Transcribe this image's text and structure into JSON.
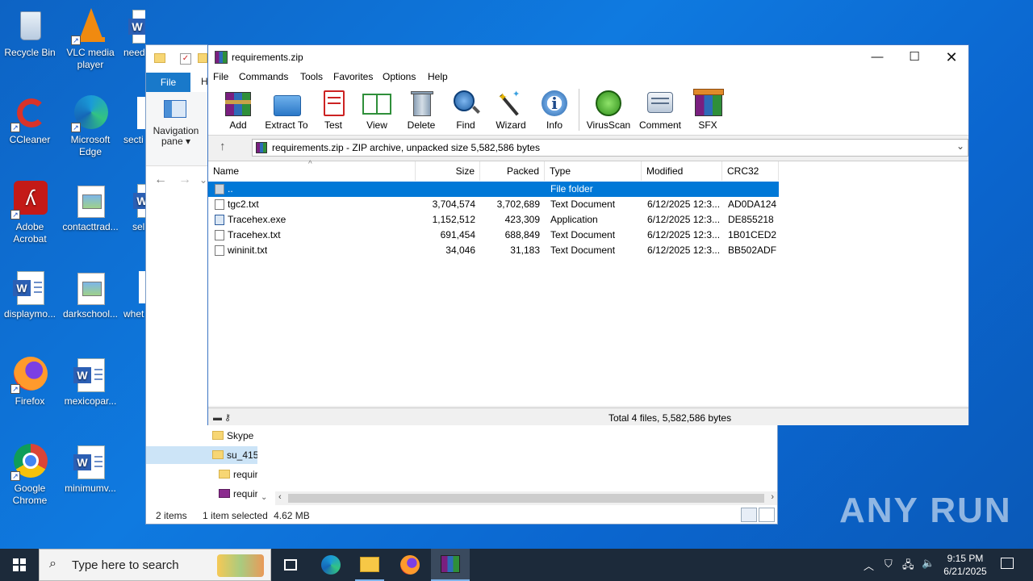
{
  "desktop": {
    "icons": [
      {
        "label": "Recycle Bin"
      },
      {
        "label": "VLC media player"
      },
      {
        "label": "need"
      },
      {
        "label": "CCleaner"
      },
      {
        "label": "Microsoft Edge"
      },
      {
        "label": "secti"
      },
      {
        "label": "Adobe Acrobat"
      },
      {
        "label": "contacttrad..."
      },
      {
        "label": "sel"
      },
      {
        "label": "displaymo..."
      },
      {
        "label": "darkschool..."
      },
      {
        "label": "whet"
      },
      {
        "label": "Firefox"
      },
      {
        "label": "mexicopar..."
      },
      {
        "label": "Google Chrome"
      },
      {
        "label": "minimumv..."
      }
    ]
  },
  "explorer": {
    "file_tab": "File",
    "h_tab": "H",
    "nav_pane": "Navigation pane",
    "nav_pane_arrow": "▾",
    "tree": [
      {
        "label": "Skype"
      },
      {
        "label": "su_415"
      },
      {
        "label": "requir"
      },
      {
        "label": "requir"
      }
    ],
    "status_items": "2 items",
    "status_selected": "1 item selected",
    "status_size": "4.62 MB"
  },
  "winrar": {
    "title": "requirements.zip",
    "menu": [
      "File",
      "Commands",
      "Tools",
      "Favorites",
      "Options",
      "Help"
    ],
    "toolbar": [
      {
        "label": "Add",
        "icon": "add-icon"
      },
      {
        "label": "Extract To",
        "icon": "extract-icon"
      },
      {
        "label": "Test",
        "icon": "test-icon"
      },
      {
        "label": "View",
        "icon": "view-icon"
      },
      {
        "label": "Delete",
        "icon": "delete-icon"
      },
      {
        "label": "Find",
        "icon": "find-icon"
      },
      {
        "label": "Wizard",
        "icon": "wizard-icon"
      },
      {
        "label": "Info",
        "icon": "info-icon"
      },
      {
        "label": "VirusScan",
        "icon": "virusscan-icon"
      },
      {
        "label": "Comment",
        "icon": "comment-icon"
      },
      {
        "label": "SFX",
        "icon": "sfx-icon"
      }
    ],
    "address": "requirements.zip - ZIP archive, unpacked size 5,582,586 bytes",
    "columns": [
      "Name",
      "Size",
      "Packed",
      "Type",
      "Modified",
      "CRC32"
    ],
    "rows": [
      {
        "name": "..",
        "size": "",
        "packed": "",
        "type": "File folder",
        "modified": "",
        "crc": ""
      },
      {
        "name": "tgc2.txt",
        "size": "3,704,574",
        "packed": "3,702,689",
        "type": "Text Document",
        "modified": "6/12/2025 12:3...",
        "crc": "AD0DA124"
      },
      {
        "name": "Tracehex.exe",
        "size": "1,152,512",
        "packed": "423,309",
        "type": "Application",
        "modified": "6/12/2025 12:3...",
        "crc": "DE855218"
      },
      {
        "name": "Tracehex.txt",
        "size": "691,454",
        "packed": "688,849",
        "type": "Text Document",
        "modified": "6/12/2025 12:3...",
        "crc": "1B01CED2"
      },
      {
        "name": "wininit.txt",
        "size": "34,046",
        "packed": "31,183",
        "type": "Text Document",
        "modified": "6/12/2025 12:3...",
        "crc": "BB502ADF"
      }
    ],
    "status": "Total 4 files, 5,582,586 bytes"
  },
  "taskbar": {
    "search_placeholder": "Type here to search",
    "time": "9:15 PM",
    "date": "6/21/2025"
  },
  "watermark": "ANY RUN"
}
